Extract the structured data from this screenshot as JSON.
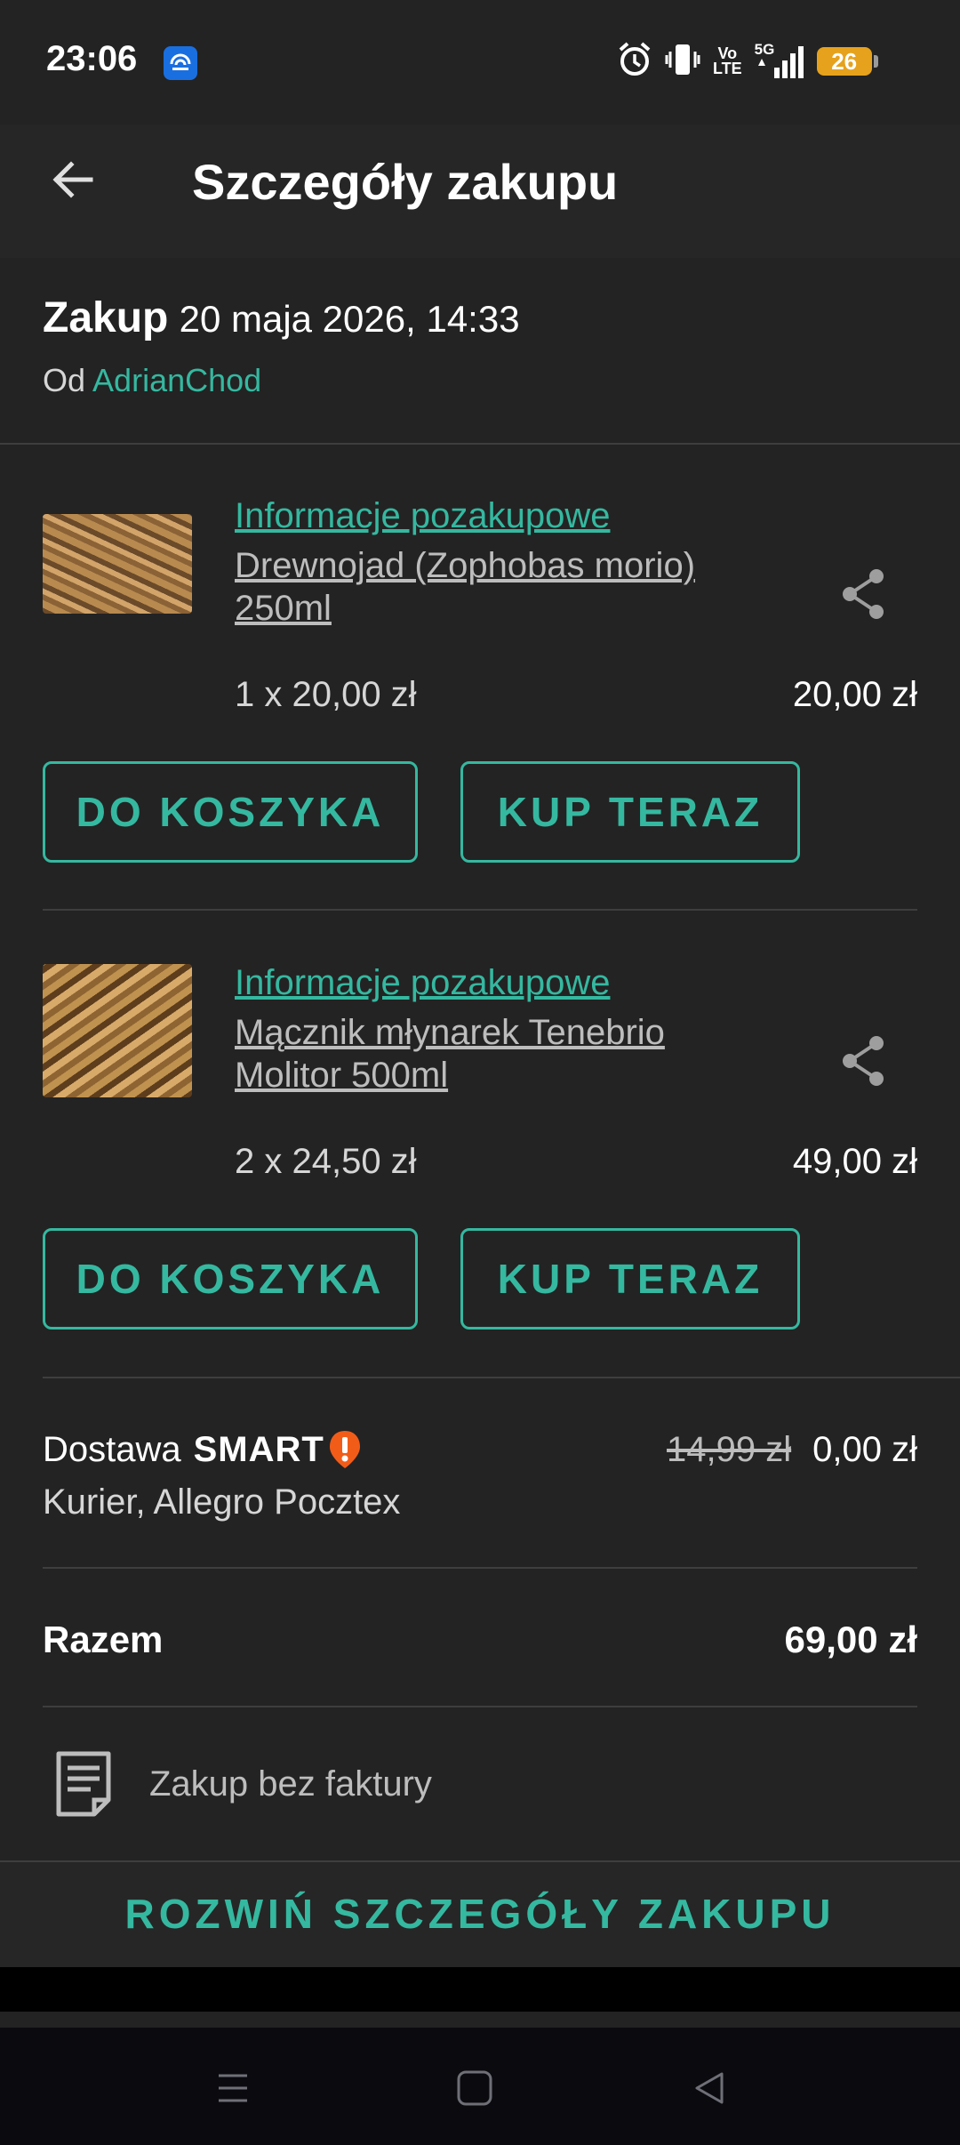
{
  "status_bar": {
    "time": "23:06",
    "battery": "26",
    "network": "5G",
    "volte": [
      "Vo",
      "LTE"
    ],
    "icons": [
      "hotspot-icon",
      "alarm-icon",
      "vibrate-icon",
      "volte-icon",
      "signal-icon",
      "battery-icon"
    ]
  },
  "header": {
    "title": "Szczegóły zakupu",
    "back_icon": "arrow-left-icon"
  },
  "purchase": {
    "label": "Zakup",
    "date": "20 maja 2026, 14:33",
    "from_label": "Od",
    "seller": "AdrianChod"
  },
  "items": [
    {
      "info_link": "Informacje pozakupowe",
      "name_line1": "Drewnojad (Zophobas morio)",
      "name_line2": "250ml",
      "quantity": "1 x 20,00 zł",
      "total": "20,00 zł",
      "btn_cart": "DO KOSZYKA",
      "btn_buy": "KUP TERAZ"
    },
    {
      "info_link": "Informacje pozakupowe",
      "name_line1": "Mącznik młynarek Tenebrio",
      "name_line2": "Molitor 500ml",
      "quantity": "2 x 24,50 zł",
      "total": "49,00 zł",
      "btn_cart": "DO KOSZYKA",
      "btn_buy": "KUP TERAZ"
    }
  ],
  "delivery": {
    "label": "Dostawa",
    "smart_label": "SMART",
    "method": "Kurier, Allegro Pocztex",
    "old_price": "14,99 zł",
    "price": "0,00 zł"
  },
  "total": {
    "label": "Razem",
    "value": "69,00 zł"
  },
  "invoice": {
    "text": "Zakup bez faktury"
  },
  "expand": {
    "label": "ROZWIŃ SZCZEGÓŁY ZAKUPU"
  },
  "colors": {
    "accent": "#35b8a0",
    "background": "#232323",
    "smart_badge": "#f25c19"
  }
}
